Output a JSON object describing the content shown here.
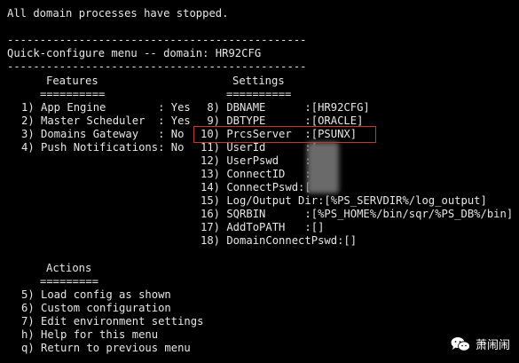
{
  "terminal": {
    "status_line": "All domain processes have stopped.",
    "separator": "----------------------------------------------",
    "menu_title": "Quick-configure menu -- domain: HR92CFG",
    "features_header": "Features",
    "features_underline": "==========",
    "settings_header": "Settings",
    "settings_underline": "==========",
    "features": [
      "1) App Engine        : Yes",
      "2) Master Scheduler  : Yes",
      "3) Domains Gateway   : No",
      "4) Push Notifications: No"
    ],
    "settings": [
      " 8) DBNAME      :[HR92CFG]",
      " 9) DBTYPE      :[ORACLE]",
      "10) PrcsServer  :[PSUNX]",
      "11) UserId      :[",
      "12) UserPswd    :[",
      "13) ConnectID   :[",
      "14) ConnectPswd:[",
      "15) Log/Output Dir:[%PS_SERVDIR%/log_output]",
      "16) SQRBIN      :[%PS_HOME%/bin/sqr/%PS_DB%/bin]",
      "17) AddToPATH   :[]",
      "18) DomainConnectPswd:[]"
    ],
    "actions_header": "Actions",
    "actions_underline": "=========",
    "actions": [
      "5) Load config as shown",
      "6) Custom configuration",
      "7) Edit environment settings",
      "h) Help for this menu",
      "q) Return to previous menu"
    ]
  },
  "watermark": {
    "text": "萧闹闹",
    "icon": "wechat-icon"
  },
  "colors": {
    "background": "#000000",
    "text": "#e6e6e6",
    "highlight_border": "#c0392b"
  }
}
